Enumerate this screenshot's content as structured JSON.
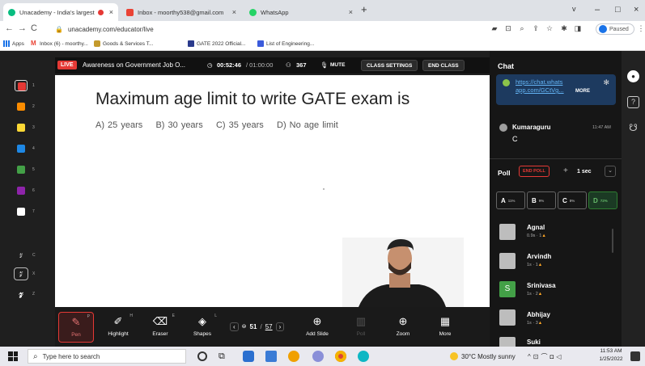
{
  "browser": {
    "tabs": [
      {
        "title": "Unacademy - India's largest",
        "active": true,
        "fav_color": "#08bd80"
      },
      {
        "title": "Inbox - moorthy538@gmail.com",
        "active": false,
        "fav_color": "#ea4335"
      },
      {
        "title": "WhatsApp",
        "active": false,
        "fav_color": "#25d366"
      }
    ],
    "new_tab": "+",
    "window_controls": [
      "v",
      "–",
      "□",
      "×"
    ],
    "url": "unacademy.com/educator/live",
    "paused_label": "Paused",
    "bookmarks": [
      {
        "label": "Apps",
        "icon": "apps-icon"
      },
      {
        "label": "Inbox (6) - moorthy...",
        "icon": "gmail-icon"
      },
      {
        "label": "Goods & Services T...",
        "icon": "gst-icon"
      },
      {
        "label": "GATE 2022 Official...",
        "icon": "gate-icon"
      },
      {
        "label": "List of Engineering...",
        "icon": "list-icon"
      }
    ]
  },
  "topbar": {
    "live": "LIVE",
    "title": "Awareness on Government Job O...",
    "timer": "00:52:46",
    "timer_total": "/ 01:00:00",
    "viewers": "367",
    "mute": "MUTE",
    "class_settings": "CLASS SETTINGS",
    "end_class": "END CLASS"
  },
  "colors": [
    {
      "num": "1",
      "color": "#e53935"
    },
    {
      "num": "2",
      "color": "#fb8c00"
    },
    {
      "num": "3",
      "color": "#fdd835"
    },
    {
      "num": "4",
      "color": "#1e88e5"
    },
    {
      "num": "5",
      "color": "#43a047"
    },
    {
      "num": "6",
      "color": "#8e24aa"
    },
    {
      "num": "7",
      "color": "#ffffff"
    }
  ],
  "strokes": [
    {
      "key": "C"
    },
    {
      "key": "X"
    },
    {
      "key": "Z"
    }
  ],
  "slide": {
    "question": "Maximum age limit to write GATE exam is",
    "options": "A) 25 years    B) 30 years    C) 35 years    D) No age limit"
  },
  "tools": [
    {
      "label": "Pen",
      "key": "P",
      "icon": "pen-icon",
      "glyph": "✎",
      "active": true
    },
    {
      "label": "Highlight",
      "key": "H",
      "icon": "highlight-icon",
      "glyph": "✐",
      "active": false
    },
    {
      "label": "Eraser",
      "key": "E",
      "icon": "eraser-icon",
      "glyph": "⌫",
      "active": false
    },
    {
      "label": "Shapes",
      "key": "L",
      "icon": "shapes-icon",
      "glyph": "◈",
      "active": false
    }
  ],
  "pager": {
    "current": "51",
    "total": "57"
  },
  "tools_right": [
    {
      "label": "Add Slide",
      "icon": "add-slide-icon",
      "glyph": "⊕",
      "dim": false
    },
    {
      "label": "Poll",
      "icon": "poll-icon",
      "glyph": "▥",
      "dim": true
    },
    {
      "label": "Zoom",
      "icon": "zoom-icon",
      "glyph": "⊕",
      "dim": false
    },
    {
      "label": "More",
      "icon": "more-icon",
      "glyph": "▦",
      "dim": false
    }
  ],
  "chat": {
    "heading": "Chat",
    "pinned_link": "https://chat.whats app.com/GCtVg...",
    "pinned_more": "MORE",
    "message_user": "Kumaraguru",
    "message_time": "11:47 AM",
    "message_text": "C"
  },
  "poll": {
    "heading": "Poll",
    "end_poll": "END POLL",
    "plus": "+",
    "time": "1 sec",
    "options": [
      {
        "label": "A",
        "pct": "11%"
      },
      {
        "label": "B",
        "pct": "9%"
      },
      {
        "label": "C",
        "pct": "8%"
      },
      {
        "label": "D",
        "pct": "72%"
      }
    ],
    "responders": [
      {
        "name": "Agnal",
        "meta": "0.9s · 1",
        "avatar": "",
        "avatar_color": "#bdbdbd"
      },
      {
        "name": "Arvindh",
        "meta": "1s · 1",
        "avatar": "",
        "avatar_color": "#bdbdbd"
      },
      {
        "name": "Srinivasa",
        "meta": "1s · 2",
        "avatar": "S",
        "avatar_color": "#43a047"
      },
      {
        "name": "Abhijay",
        "meta": "1s · 3",
        "avatar": "",
        "avatar_color": "#bdbdbd"
      },
      {
        "name": "Suki",
        "meta": "",
        "avatar": "",
        "avatar_color": "#bdbdbd"
      }
    ]
  },
  "taskbar": {
    "search_placeholder": "Type here to search",
    "weather": "30°C Mostly sunny",
    "time": "11:53 AM",
    "date": "1/25/2022"
  }
}
